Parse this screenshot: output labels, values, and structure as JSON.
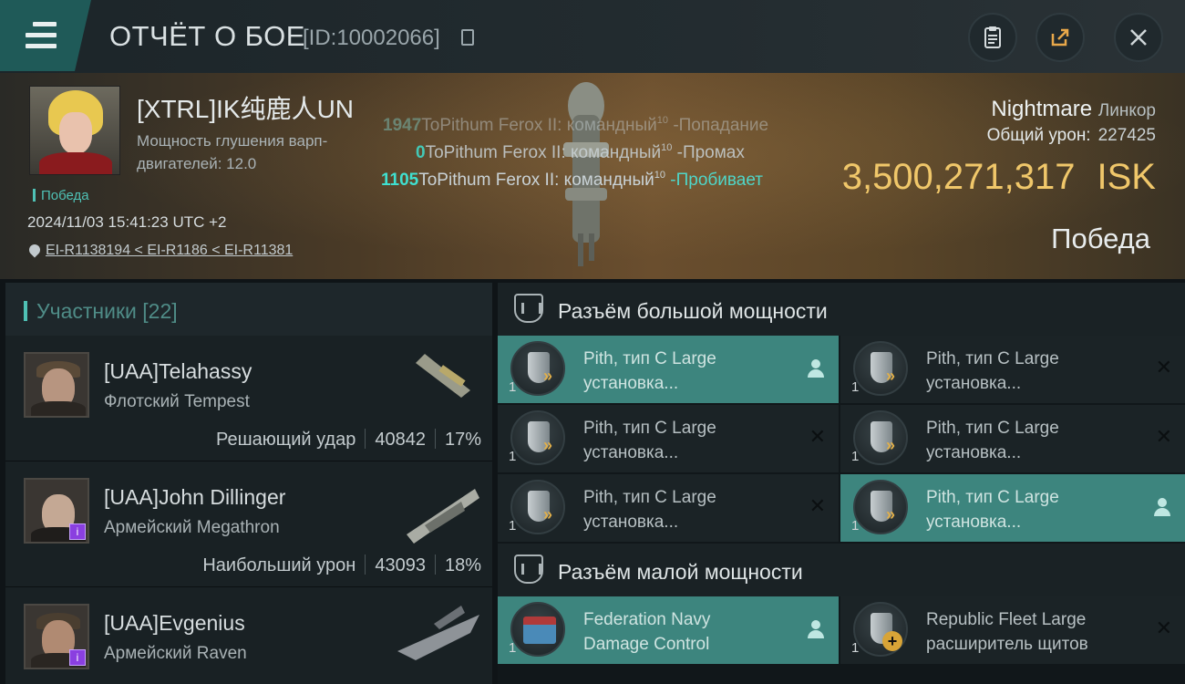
{
  "header": {
    "title": "ОТЧЁТ О БОЕ",
    "report_id": "[ID:10002066]"
  },
  "victim": {
    "name": "[XTRL]IK纯鹿人UN",
    "warp_disruption": "Мощность глушения варп-двигателей: 12.0",
    "victory_tag": "Победа",
    "datetime": "2024/11/03 15:41:23 UTC +2",
    "location": "EI-R1138194 < EI-R1186 < EI-R11381"
  },
  "damage_log": [
    {
      "value": "1947",
      "target": "ToPithum Ferox II: командный",
      "level": "10",
      "result": "-Попадание"
    },
    {
      "value": "0",
      "target": "ToPithum Ferox II: командный",
      "level": "10",
      "result": "-Промах"
    },
    {
      "value": "1105",
      "target": "ToPithum Ferox II: командный",
      "level": "10",
      "result": "-Пробивает"
    }
  ],
  "ship": {
    "name": "Nightmare",
    "class": "Линкор",
    "total_damage_label": "Общий урон:",
    "total_damage": "227425",
    "isk_value": "3,500,271,317",
    "isk_currency": "ISK",
    "result": "Победа"
  },
  "participants": {
    "label": "Участники [22]",
    "rows": [
      {
        "name": "[UAA]Telahassy",
        "ship": "Флотский Tempest",
        "stat_label": "Решающий удар",
        "damage": "40842",
        "percent": "17%"
      },
      {
        "name": "[UAA]John Dillinger",
        "ship": "Армейский Megathron",
        "stat_label": "Наибольший урон",
        "damage": "43093",
        "percent": "18%"
      },
      {
        "name": "[UAA]Evgenius",
        "ship": "Армейский Raven",
        "stat_label": "",
        "damage": "",
        "percent": ""
      }
    ]
  },
  "modules": {
    "high_slot_label": "Разъём большой мощности",
    "low_slot_label": "Разъём малой мощности",
    "high": [
      {
        "qty": "1",
        "line1": "Pith, тип C Large",
        "line2": "установка...",
        "state": "fitted"
      },
      {
        "qty": "1",
        "line1": "Pith, тип C Large",
        "line2": "установка...",
        "state": "destroyed"
      },
      {
        "qty": "1",
        "line1": "Pith, тип C Large",
        "line2": "установка...",
        "state": "destroyed"
      },
      {
        "qty": "1",
        "line1": "Pith, тип C Large",
        "line2": "установка...",
        "state": "destroyed"
      },
      {
        "qty": "1",
        "line1": "Pith, тип C Large",
        "line2": "установка...",
        "state": "destroyed"
      },
      {
        "qty": "1",
        "line1": "Pith, тип C Large",
        "line2": "установка...",
        "state": "fitted"
      }
    ],
    "low": [
      {
        "qty": "1",
        "line1": "Federation Navy",
        "line2": "Damage Control",
        "state": "fitted"
      },
      {
        "qty": "1",
        "line1": "Republic Fleet Large",
        "line2": "расширитель щитов",
        "state": "destroyed"
      }
    ]
  },
  "colors": {
    "accent": "#4fc1b5",
    "isk": "#f0c76a",
    "active_module": "#3d857e"
  }
}
